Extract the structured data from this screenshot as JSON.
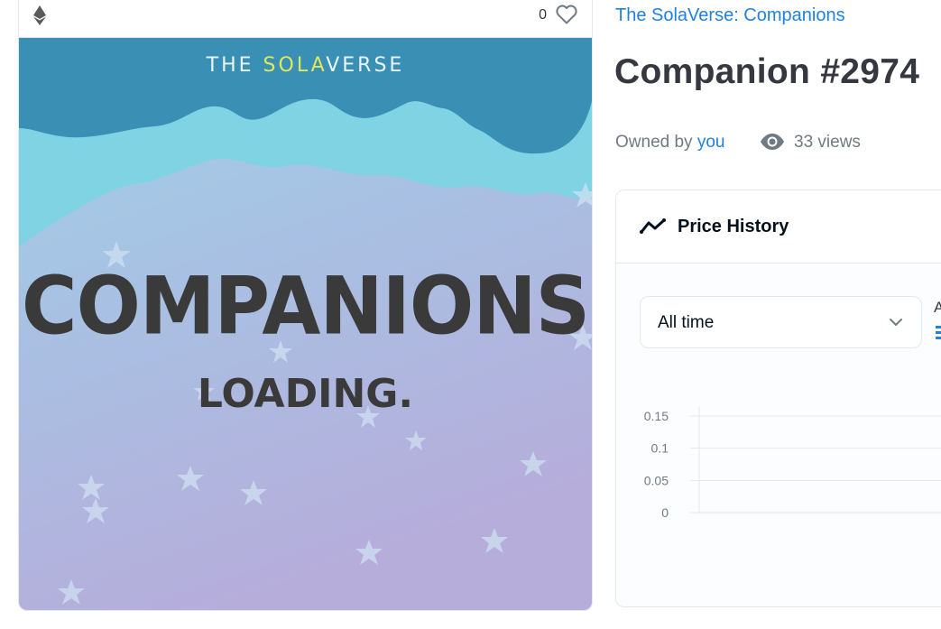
{
  "media": {
    "favorite_count": "0",
    "artwork": {
      "brand_prefix": "THE ",
      "brand_highlight": "SOLA",
      "brand_suffix": "VERSE",
      "headline": "COMPANIONS",
      "subline": "LOADING."
    }
  },
  "item": {
    "collection_name": "The SolaVerse: Companions",
    "title": "Companion #2974",
    "owned_by_label": "Owned by",
    "owner": "you",
    "views": "33 views"
  },
  "price_history": {
    "title": "Price History",
    "range_selected": "All time",
    "avg_label_partial": "A"
  },
  "chart_data": {
    "type": "line",
    "title": "",
    "xlabel": "",
    "ylabel": "",
    "y_ticks": [
      "0.15",
      "0.1",
      "0.05",
      "0"
    ],
    "ylim": [
      0,
      0.15
    ],
    "series": []
  },
  "colors": {
    "link": "#2081e2",
    "text_muted": "#707a83",
    "heading": "#353840",
    "sky_top": "#3a8fb5",
    "sky_mid": "#7fd3e3",
    "art_highlight": "#dfe85a"
  },
  "icons": {
    "chain": "ethereum-icon",
    "favorite": "heart-icon",
    "views": "eye-icon",
    "price_history": "trending-icon",
    "dropdown": "chevron-down-icon"
  }
}
